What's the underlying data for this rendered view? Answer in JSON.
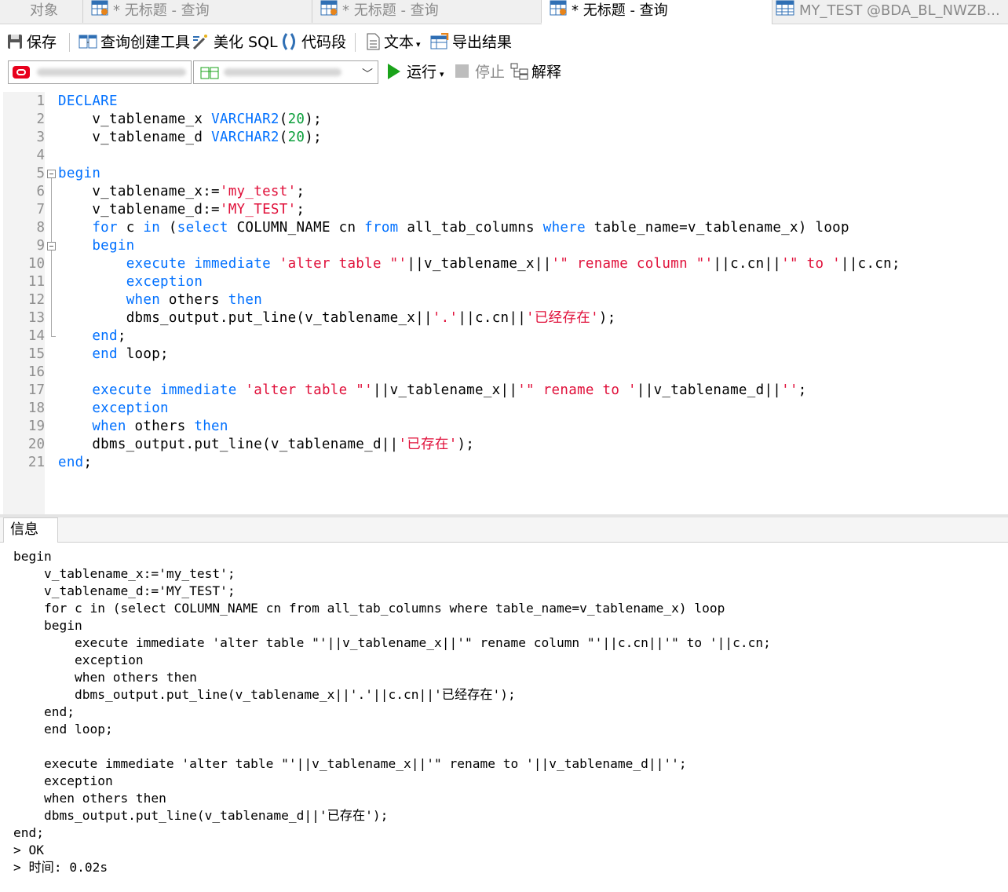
{
  "tabs": [
    {
      "label": "对象",
      "active": false
    },
    {
      "label": "* 无标题 - 查询",
      "active": false
    },
    {
      "label": "* 无标题 - 查询",
      "active": false
    },
    {
      "label": "* 无标题 - 查询",
      "active": true
    },
    {
      "label": "MY_TEST @BDA_BL_NWZB...",
      "active": false
    }
  ],
  "toolbar": {
    "save": "保存",
    "query_builder": "查询创建工具",
    "beautify": "美化 SQL",
    "snippet": "代码段",
    "text": "文本",
    "export": "导出结果",
    "run": "运行",
    "stop": "停止",
    "explain": "解释"
  },
  "editor": {
    "line_numbers": [
      "1",
      "2",
      "3",
      "4",
      "5",
      "6",
      "7",
      "8",
      "9",
      "10",
      "11",
      "12",
      "13",
      "14",
      "15",
      "16",
      "17",
      "18",
      "19",
      "20",
      "21"
    ]
  },
  "messages": {
    "tab_label": "信息",
    "lines": [
      "begin",
      "    v_tablename_x:='my_test';",
      "    v_tablename_d:='MY_TEST';",
      "    for c in (select COLUMN_NAME cn from all_tab_columns where table_name=v_tablename_x) loop",
      "    begin",
      "        execute immediate 'alter table \"'||v_tablename_x||'\" rename column \"'||c.cn||'\" to '||c.cn;",
      "        exception",
      "        when others then",
      "        dbms_output.put_line(v_tablename_x||'.'||c.cn||'已经存在');",
      "    end;",
      "    end loop;",
      "",
      "    execute immediate 'alter table \"'||v_tablename_x||'\" rename to '||v_tablename_d||'';",
      "    exception",
      "    when others then",
      "    dbms_output.put_line(v_tablename_d||'已存在');",
      "end;",
      "> OK",
      "> 时间: 0.02s"
    ]
  },
  "colors": {
    "keyword": "#0070ff",
    "string": "#e0103a",
    "number": "#0a9e3a",
    "run_green": "#1aa31a"
  }
}
